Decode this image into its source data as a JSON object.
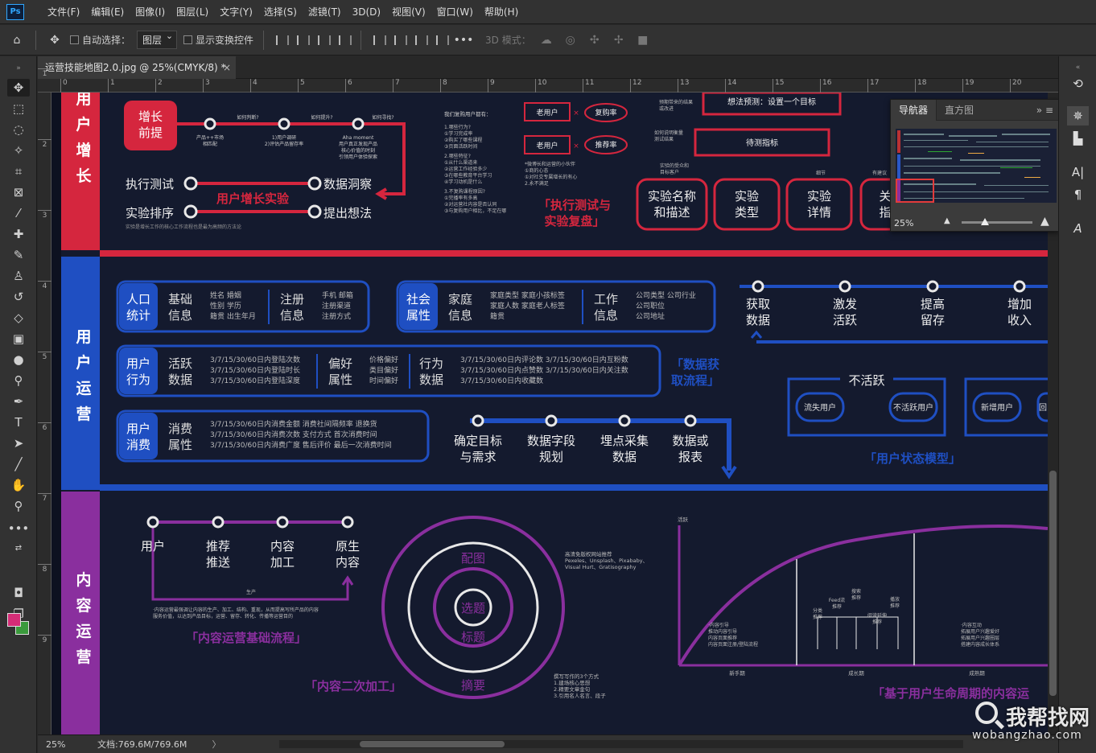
{
  "app": {
    "logo": "Ps"
  },
  "menu": [
    "文件(F)",
    "编辑(E)",
    "图像(I)",
    "图层(L)",
    "文字(Y)",
    "选择(S)",
    "滤镜(T)",
    "3D(D)",
    "视图(V)",
    "窗口(W)",
    "帮助(H)"
  ],
  "options": {
    "auto_select_label": "自动选择：",
    "layer_dropdown": "图层",
    "show_transform_label": "显示变换控件",
    "more": "•••",
    "mode_3d": "3D 模式："
  },
  "document": {
    "tab_title": "运营技能地图2.0.jpg @ 25%(CMYK/8) *",
    "close": "×"
  },
  "ruler": {
    "h_ticks": [
      "0",
      "1",
      "2",
      "3",
      "4",
      "5",
      "6",
      "7",
      "8",
      "9",
      "10",
      "11",
      "12",
      "13",
      "14",
      "15",
      "16",
      "17",
      "18",
      "19",
      "20"
    ],
    "v_ticks": [
      "1",
      "2",
      "3",
      "4",
      "5",
      "6",
      "7",
      "8",
      "9"
    ]
  },
  "navigator": {
    "tab_active": "导航器",
    "tab_other": "直方图",
    "menu": "»  ≡",
    "zoom": "25%"
  },
  "status": {
    "zoom": "25%",
    "doc_info": "文档:769.6M/769.6M",
    "arrow": "〉"
  },
  "watermark": {
    "cn": "我帮找网",
    "en": "wobangzhao.com"
  },
  "colors": {
    "fg": "#d42d77",
    "bg": "#3a9a3c",
    "canvas_bg": "#141a2e",
    "red": "#d5263e",
    "blue": "#1f4fc2",
    "purple": "#8a2f9e"
  },
  "art": {
    "sec1": {
      "label": "用户增长",
      "box": "增长前提",
      "q1": "如何判断?",
      "q2": "如何提升?",
      "q3": "如何寻找?",
      "n1": "产品++市场\n相匹配",
      "n2": "1)用户调研\n2)评估产品留存率",
      "n3": "Aha moment\n用户真正发现产品\n核心价值的时刻\n引领用户体验探索",
      "exp": "用户增长实验",
      "a": "执行测试",
      "b": "数据洞察",
      "c": "实验排序",
      "d": "提出想法",
      "note": "实验是增长工作的核心工作流程也是最为高频的方法论",
      "ret_title": "我们复购用户都有：",
      "ret": [
        "1.哪些行为?",
        "①学习完成率",
        "②购买了哪些课程",
        "③页面活跃时间",
        "2.哪些特征?",
        "①从什么渠道来",
        "②运营工作经验多少",
        "③在哪些教育平台学习",
        "④学习动机是什么",
        "3.不复购课程原因?",
        "①完播率有多高",
        "②对运营社内容是否认同",
        "③与复购用户相比，不足在哪"
      ],
      "old1": "老用户",
      "rate1": "复购率",
      "old2": "老用户",
      "rate2": "推荐率",
      "hint": "*微博长和运营的小伙伴\n①商的心态\n①对社交专属增长的有心\n2.永不满足",
      "title_exec": "「执行测试与\n实验复盘」",
      "pred": "想法预测：设置一个目标",
      "metric": "待测指标",
      "small1": "预期带来的结果\n或改进",
      "small2": "如何说明衡量\n测试结果",
      "small3": "实验的受众和\n目标客户",
      "small4": "细节",
      "small5": "有建议",
      "cards": [
        "实验名称\n和描述",
        "实验\n类型",
        "实验\n详情",
        "关\n指"
      ]
    },
    "sec2": {
      "label": "用户运营",
      "g1": "人口\n统计",
      "g1a": "基础\n信息",
      "g1a_t": "姓名 婚姻\n性别 学历\n籍贯 出生年月",
      "g1b": "注册\n信息",
      "g1b_t": "手机 邮箱\n注册渠道\n注册方式",
      "g2": "社会\n属性",
      "g2a": "家庭\n信息",
      "g2a_t": "家庭类型 家庭小孩标签\n家庭人数 家庭老人标签\n籍贯",
      "g2b": "工作\n信息",
      "g2b_t": "公司类型 公司行业\n公司职位\n公司地址",
      "g3": "用户\n行为",
      "g3a": "活跃\n数据",
      "g3a_t": "3/7/15/30/60日内登陆次数\n3/7/15/30/60日内登陆时长\n3/7/15/30/60日内登陆深度",
      "g3b": "偏好\n属性",
      "g3b_t": "价格偏好\n类目偏好\n时间偏好",
      "g3c": "行为\n数据",
      "g3c_t": "3/7/15/30/60日内评论数 3/7/15/30/60日内互粉数\n3/7/15/30/60日内点赞数 3/7/15/30/60日内关注数\n3/7/15/30/60日内收藏数",
      "g4": "用户\n消费",
      "g4a": "消费\n属性",
      "g4a_t": "3/7/15/30/60日内消费金额 消费社间隔频率 退换货\n3/7/15/30/60日内消费次数 支付方式 首次消费时间\n3/7/15/30/60日内消费广度 售后评价 最后一次消费时间",
      "flow": [
        "获取\n数据",
        "激发\n活跃",
        "提高\n留存",
        "增加\n收入"
      ],
      "title_data": "「数据获\n取流程」",
      "steps": [
        "确定目标\n与需求",
        "数据字段\n规划",
        "埋点采集\n数据",
        "数据或\n报表"
      ],
      "inactive": "不活跃",
      "states": [
        "流失用户",
        "不活跃用户",
        "新增用户",
        "回"
      ],
      "title_state": "「用户状态模型」"
    },
    "sec3": {
      "label": "内容运营",
      "nodes": [
        "用户",
        "推荐\n推送",
        "内容\n加工",
        "原生\n内容"
      ],
      "produce": "生产",
      "note": "·内容运营最强调让内容的生产、加工、结构、重现，从而提高写所产品的内容\n服务价值，以达到产品目标，运营、留存、转化、传播等运营目的",
      "title_base": "「内容运营基础流程」",
      "rings": [
        "配图",
        "选题",
        "标题",
        "摘要"
      ],
      "title_second": "「内容二次加工」",
      "src": "高清免版权网站推荐\nPexeles、Unsplash、Pixababy、\nVisual Hurt、Gratisography",
      "tips": "撰写写作的3个方式\n1.建场核心思想\n2.精要文章金句\n3.引用名人名言、段子",
      "active": "活跃",
      "life": [
        "新手期",
        "成长期",
        "成熟期"
      ],
      "mid": [
        "分类\n推荐",
        "Feed流\n推荐",
        "搜索\n推荐",
        "阅读延伸\n推荐",
        "播放\n推荐"
      ],
      "life_note1": "·内容引导\n推动内容引导\n内容页面推荐\n内容页面注册/登陆流程",
      "life_note2": "·内容互动\n拓展用户兴趣爱好\n拓展用户兴趣圈层\n搭建内容成长体系",
      "title_life": "「基于用户生命周期的内容运"
    }
  }
}
